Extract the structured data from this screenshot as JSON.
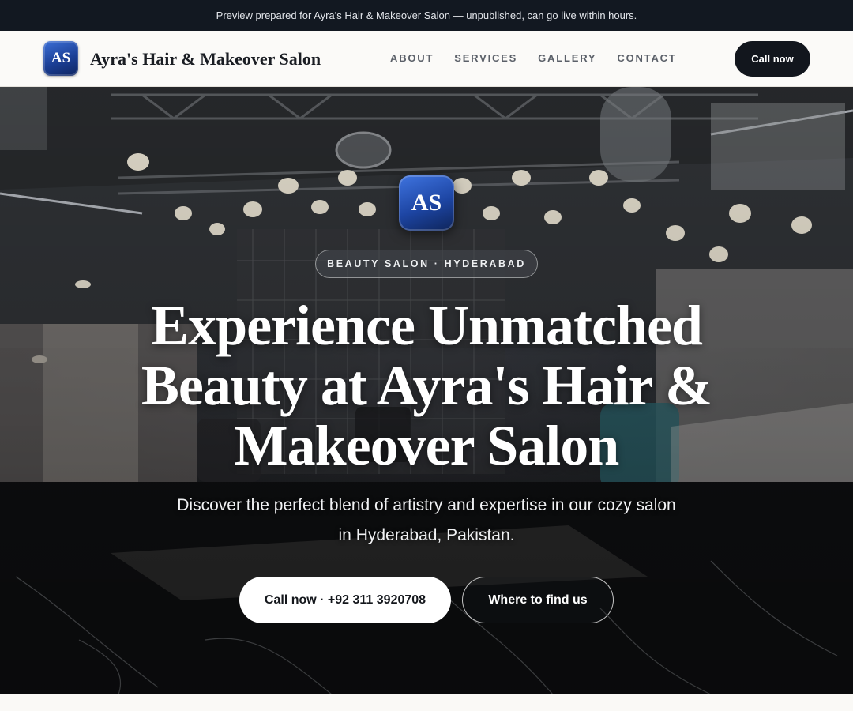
{
  "announcement": "Preview prepared for Ayra's Hair & Makeover Salon — unpublished, can go live within hours.",
  "header": {
    "logo_initials": "AS",
    "brand_name": "Ayra's Hair & Makeover Salon",
    "nav": [
      "ABOUT",
      "SERVICES",
      "GALLERY",
      "CONTACT"
    ],
    "call_label": "Call now"
  },
  "hero": {
    "logo_initials": "AS",
    "eyebrow": "BEAUTY SALON · HYDERABAD",
    "headline": "Experience Unmatched Beauty at Ayra's Hair & Makeover Salon",
    "subhead": "Discover the perfect blend of artistry and expertise in our cozy salon in Hyderabad, Pakistan.",
    "cta_primary": "Call now · +92 311 3920708",
    "cta_secondary": "Where to find us",
    "background_image": "salon-interior-photo"
  },
  "colors": {
    "topbar_bg": "#121821",
    "header_bg": "#fbfaf8",
    "badge_blue": "#1d45a3",
    "cta_dark": "#12161d",
    "text_dark": "#1a1d23"
  }
}
